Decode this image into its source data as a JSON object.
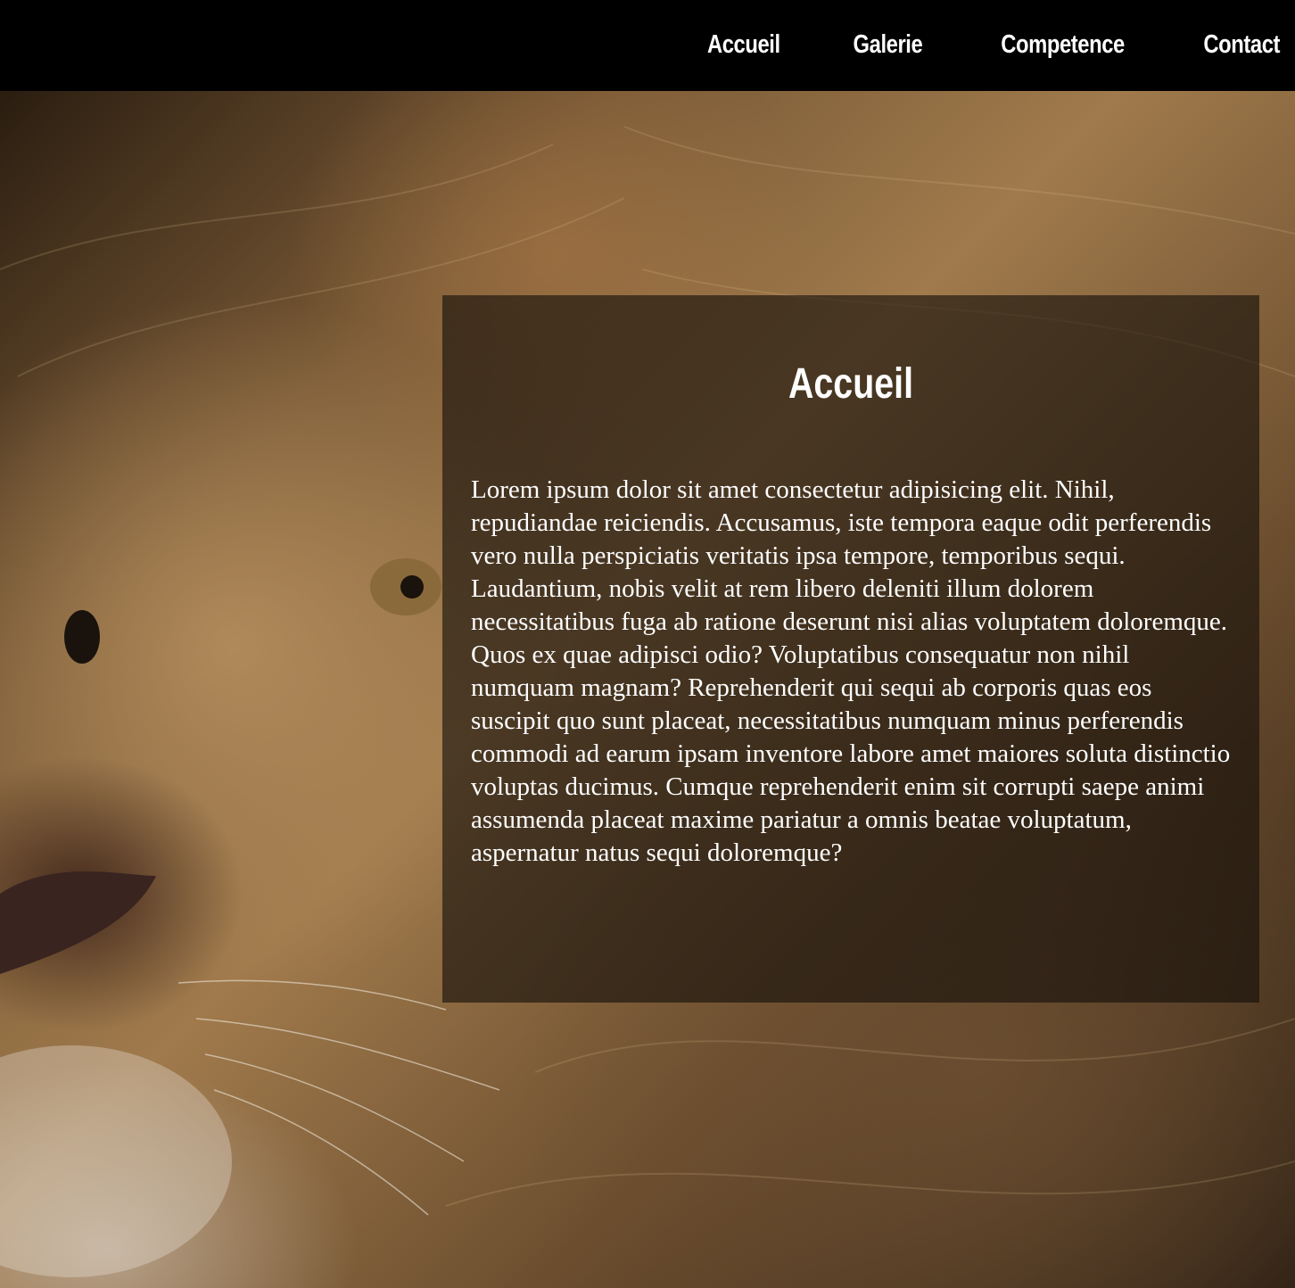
{
  "nav": {
    "items": [
      {
        "label": "Accueil"
      },
      {
        "label": "Galerie"
      },
      {
        "label": "Competence"
      },
      {
        "label": "Contact"
      }
    ]
  },
  "hero": {
    "image": "lion-face-photo"
  },
  "content": {
    "title": "Accueil",
    "body": "Lorem ipsum dolor sit amet consectetur adipisicing elit. Nihil, repudiandae reiciendis. Accusamus, iste tempora eaque odit perferendis vero nulla perspiciatis veritatis ipsa tempore, temporibus sequi. Laudantium, nobis velit at rem libero deleniti illum dolorem necessitatibus fuga ab ratione deserunt nisi alias voluptatem doloremque. Quos ex quae adipisci odio? Voluptatibus consequatur non nihil numquam magnam? Reprehenderit qui sequi ab corporis quas eos suscipit quo sunt placeat, necessitatibus numquam minus perferendis commodi ad earum ipsam inventore labore amet maiores soluta distinctio voluptas ducimus. Cumque reprehenderit enim sit corrupti saepe animi assumenda placeat maxime pariatur a omnis beatae voluptatum, aspernatur natus sequi doloremque?"
  },
  "colors": {
    "nav_background": "#000000",
    "nav_text": "#ffffff",
    "panel_background": "rgba(20,14,10,0.62)",
    "panel_text": "#ffffff"
  }
}
